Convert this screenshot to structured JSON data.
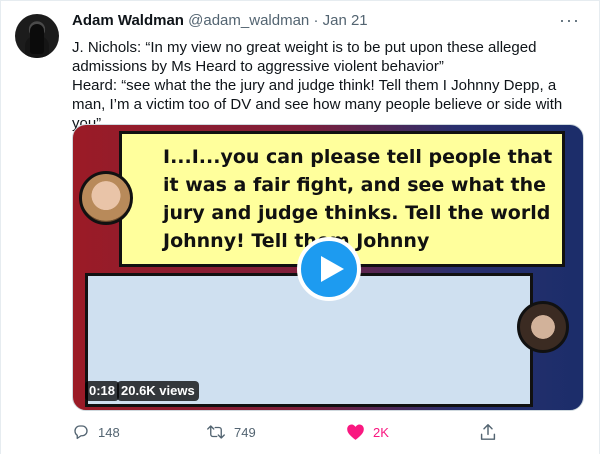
{
  "tweet": {
    "author_name": "Adam Waldman",
    "handle": "@adam_waldman",
    "separator": "·",
    "date": "Jan 21",
    "more": "···",
    "paragraph1": "J. Nichols: “In my view no great weight is to be put upon these alleged admissions by Ms Heard to aggressive violent behavior”",
    "paragraph2": "Heard: “see what the the jury and judge think! Tell them I Johnny Depp, a man, I’m a victim too of DV and see how many people believe or side with you”"
  },
  "media": {
    "caption_text": "I...I...you can please tell people that it was a fair fight, and see what the jury and judge thinks.  Tell the world Johnny! Tell them Johnny",
    "duration": "0:18",
    "views": "20.6K views"
  },
  "actions": {
    "reply_count": "148",
    "retweet_count": "749",
    "like_count": "2K",
    "reply_icon": "reply-icon",
    "retweet_icon": "retweet-icon",
    "like_icon": "heart-icon",
    "share_icon": "share-icon"
  },
  "colors": {
    "accent": "#1d9bf0",
    "like": "#f91880",
    "secondary_text": "#536471"
  }
}
